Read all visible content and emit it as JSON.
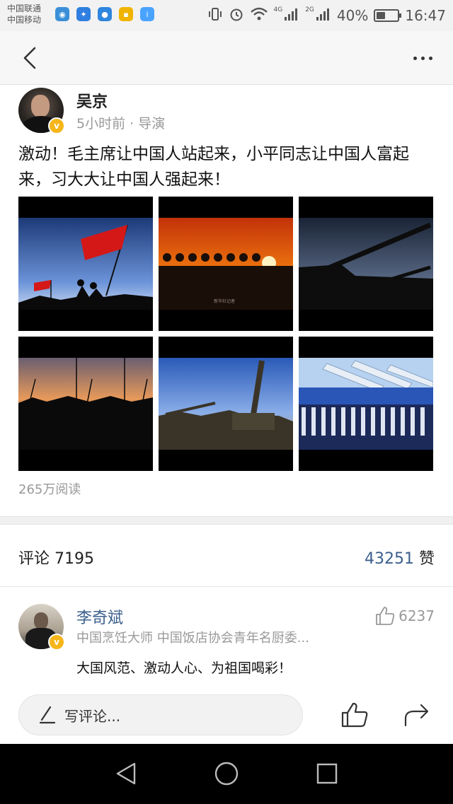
{
  "status_bar": {
    "carrier_1": "中国联通",
    "carrier_2": "中国移动",
    "network_1": "4G",
    "network_2": "2G",
    "battery": "40%",
    "battery_level": 0.4,
    "time": "16:47"
  },
  "nav": {
    "back_icon": "chevron-left-icon",
    "more_icon": "more-dots-icon"
  },
  "post": {
    "author": "吴京",
    "meta": "5小时前 · 导演",
    "verified_mark": "v",
    "text": "激动！毛主席让中国人站起来，小平同志让中国人富起来，习大大让中国人强起来！",
    "read_count": "265万阅读",
    "photo_caption": "新华社记者"
  },
  "stats": {
    "comments_label": "评论 7195",
    "likes_number": "43251",
    "likes_suffix": " 赞"
  },
  "comment": {
    "name": "李奇斌",
    "like_count": "6237",
    "subtitle": "中国烹饪大师 中国饭店协会青年名厨委...",
    "text": "大国风范、激动人心、为祖国喝彩！"
  },
  "bottom_bar": {
    "input_placeholder": "写评论..."
  },
  "colors": {
    "link_blue": "#3b5f8c",
    "verified_gold": "#f6b61a",
    "muted_gray": "#999999"
  }
}
